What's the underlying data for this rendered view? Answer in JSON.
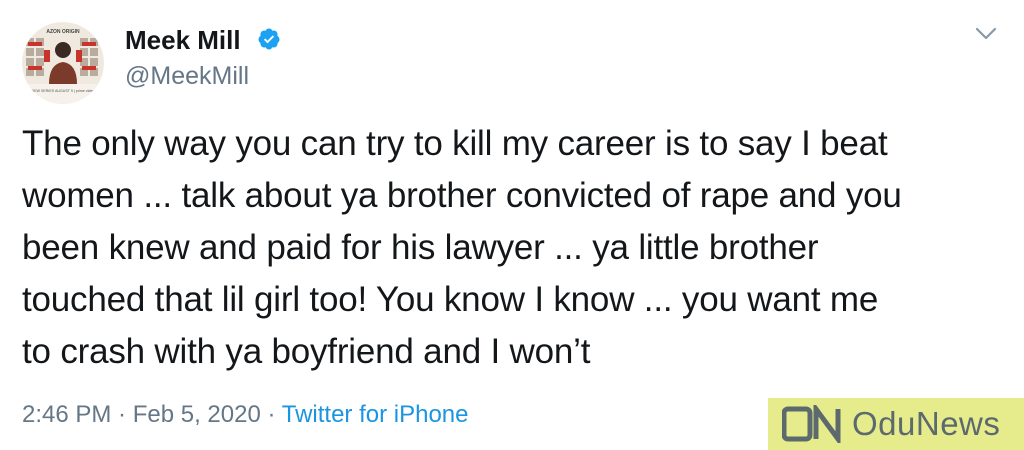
{
  "author": {
    "display_name": "Meek Mill",
    "handle": "@MeekMill",
    "verified": true,
    "avatar_icon": "avatar-poster-image",
    "avatar_text": {
      "top": "AZON ORIGIN",
      "bottom": "NEW SERIES AUGUST 9 | prime video"
    }
  },
  "tweet": {
    "lines": [
      "The only way you can try to kill my career is to say I beat",
      "women ... talk about ya brother convicted of rape and you",
      "been knew and paid for his lawyer ... ya little brother",
      "touched that lil girl too! You know I know ... you want me",
      "to crash with ya boyfriend and I won’t"
    ]
  },
  "meta": {
    "time": "2:46 PM",
    "separator": " · ",
    "date": "Feb 5, 2020",
    "source": "Twitter for iPhone"
  },
  "watermark": {
    "text": "OduNews",
    "background": "#e6ec8b"
  },
  "colors": {
    "text": "#14171a",
    "secondary": "#657786",
    "link": "#1b95e0",
    "verified": "#1da1f2"
  },
  "icons": {
    "verified": "verified-badge-icon",
    "menu": "chevron-down-icon"
  }
}
